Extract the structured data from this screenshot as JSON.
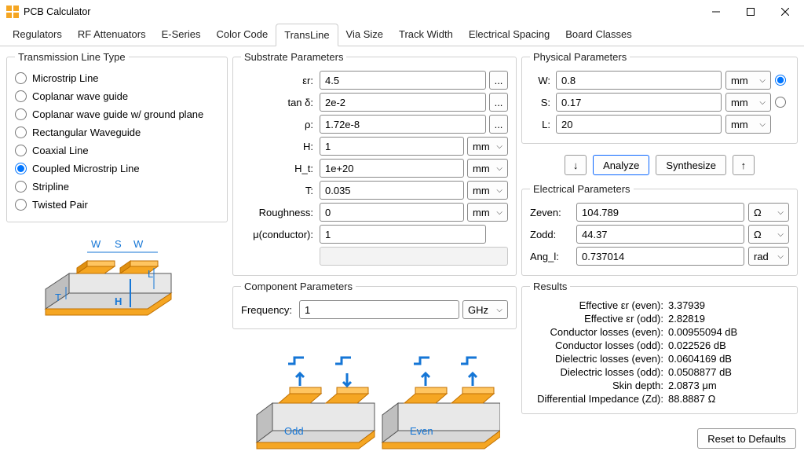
{
  "window": {
    "title": "PCB Calculator"
  },
  "tabs": [
    "Regulators",
    "RF Attenuators",
    "E-Series",
    "Color Code",
    "TransLine",
    "Via Size",
    "Track Width",
    "Electrical Spacing",
    "Board Classes"
  ],
  "active_tab": "TransLine",
  "tl_types": {
    "legend": "Transmission Line Type",
    "options": [
      "Microstrip Line",
      "Coplanar wave guide",
      "Coplanar wave guide w/ ground plane",
      "Rectangular Waveguide",
      "Coaxial Line",
      "Coupled Microstrip Line",
      "Stripline",
      "Twisted Pair"
    ],
    "selected": "Coupled Microstrip Line"
  },
  "substrate": {
    "legend": "Substrate Parameters",
    "er": {
      "label": "εr:",
      "value": "4.5"
    },
    "tand": {
      "label": "tan δ:",
      "value": "2e-2"
    },
    "rho": {
      "label": "ρ:",
      "value": "1.72e-8"
    },
    "H": {
      "label": "H:",
      "value": "1",
      "unit": "mm"
    },
    "Ht": {
      "label": "H_t:",
      "value": "1e+20",
      "unit": "mm"
    },
    "T": {
      "label": "T:",
      "value": "0.035",
      "unit": "mm"
    },
    "rough": {
      "label": "Roughness:",
      "value": "0",
      "unit": "mm"
    },
    "mu": {
      "label": "μ(conductor):",
      "value": "1"
    }
  },
  "component": {
    "legend": "Component Parameters",
    "freq": {
      "label": "Frequency:",
      "value": "1",
      "unit": "GHz"
    }
  },
  "physical": {
    "legend": "Physical Parameters",
    "W": {
      "label": "W:",
      "value": "0.8",
      "unit": "mm"
    },
    "S": {
      "label": "S:",
      "value": "0.17",
      "unit": "mm"
    },
    "L": {
      "label": "L:",
      "value": "20",
      "unit": "mm"
    }
  },
  "buttons": {
    "analyze": "Analyze",
    "synthesize": "Synthesize"
  },
  "electrical": {
    "legend": "Electrical Parameters",
    "zeven": {
      "label": "Zeven:",
      "value": "104.789",
      "unit": "Ω"
    },
    "zodd": {
      "label": "Zodd:",
      "value": "44.37",
      "unit": "Ω"
    },
    "angl": {
      "label": "Ang_l:",
      "value": "0.737014",
      "unit": "rad"
    }
  },
  "results": {
    "legend": "Results",
    "rows": [
      {
        "label": "Effective εr (even):",
        "value": "3.37939"
      },
      {
        "label": "Effective εr (odd):",
        "value": "2.82819"
      },
      {
        "label": "Conductor losses (even):",
        "value": "0.00955094 dB"
      },
      {
        "label": "Conductor losses (odd):",
        "value": "0.022526 dB"
      },
      {
        "label": "Dielectric losses (even):",
        "value": "0.0604169 dB"
      },
      {
        "label": "Dielectric losses (odd):",
        "value": "0.0508877 dB"
      },
      {
        "label": "Skin depth:",
        "value": "2.0873 μm"
      },
      {
        "label": "Differential Impedance (Zd):",
        "value": "88.8887 Ω"
      }
    ]
  },
  "footer": {
    "reset": "Reset to Defaults"
  },
  "diagram_labels": {
    "W1": "W",
    "S": "S",
    "W2": "W",
    "T": "T",
    "H": "H",
    "L": "L",
    "odd": "Odd",
    "even": "Even"
  }
}
